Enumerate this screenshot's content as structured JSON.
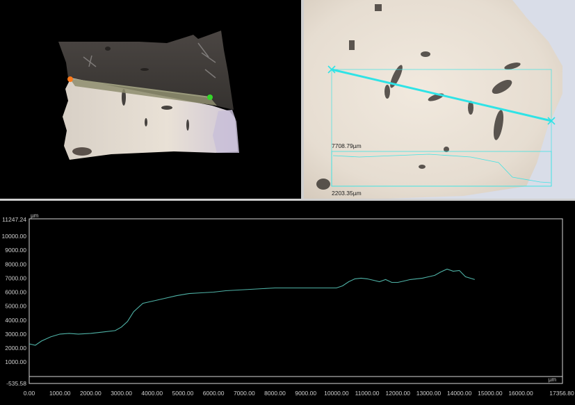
{
  "measurement": {
    "length_label": "7708.79µm",
    "height_label": "2203.35µm"
  },
  "colors": {
    "profile_line": "#4fb3a7",
    "measure_line": "#2fe3e6",
    "start_marker": "#ff7a1a",
    "end_marker": "#35d42a"
  },
  "chart_data": {
    "type": "line",
    "title": "",
    "xlabel": "",
    "ylabel": "",
    "x_unit": "µm",
    "y_unit": "µm",
    "xlim": [
      0.0,
      17356.8
    ],
    "ylim": [
      -535.58,
      11247.24
    ],
    "x_ticks": [
      "0.00",
      "1000.00",
      "2000.00",
      "3000.00",
      "4000.00",
      "5000.00",
      "6000.00",
      "7000.00",
      "8000.00",
      "9000.00",
      "10000.00",
      "11000.00",
      "12000.00",
      "13000.00",
      "14000.00",
      "15000.00",
      "16000.00"
    ],
    "x_tick_values": [
      0,
      1000,
      2000,
      3000,
      4000,
      5000,
      6000,
      7000,
      8000,
      9000,
      10000,
      11000,
      12000,
      13000,
      14000,
      15000,
      16000
    ],
    "x_max_label": "17356.80",
    "y_ticks": [
      "1000.00",
      "2000.00",
      "3000.00",
      "4000.00",
      "5000.00",
      "6000.00",
      "7000.00",
      "8000.00",
      "9000.00",
      "10000.00"
    ],
    "y_tick_values": [
      1000,
      2000,
      3000,
      4000,
      5000,
      6000,
      7000,
      8000,
      9000,
      10000
    ],
    "y_max_label": "11247.24",
    "y_min_label": "-535.58",
    "grid": false,
    "series": [
      {
        "x": [
          0,
          200,
          400,
          700,
          1000,
          1300,
          1600,
          2000,
          2400,
          2800,
          3000,
          3200,
          3400,
          3700,
          4000,
          4400,
          4800,
          5200,
          5600,
          6000,
          6400,
          6800,
          7200,
          7600,
          8000,
          8400,
          8800,
          9200,
          9600,
          10000,
          10200,
          10400,
          10600,
          10800,
          11000,
          11200,
          11400,
          11600,
          11800,
          12000,
          12200,
          12400,
          12600,
          12800,
          13000,
          13200,
          13400,
          13600,
          13800,
          14000,
          14200,
          14500
        ],
        "y": [
          2300,
          2200,
          2500,
          2800,
          3000,
          3050,
          3000,
          3050,
          3150,
          3250,
          3500,
          3900,
          4600,
          5200,
          5350,
          5550,
          5750,
          5900,
          5950,
          6000,
          6100,
          6150,
          6200,
          6250,
          6300,
          6300,
          6300,
          6300,
          6300,
          6300,
          6450,
          6750,
          6950,
          7000,
          6950,
          6850,
          6750,
          6900,
          6700,
          6700,
          6800,
          6900,
          6950,
          7000,
          7100,
          7200,
          7450,
          7650,
          7500,
          7550,
          7100,
          6900
        ]
      }
    ]
  }
}
